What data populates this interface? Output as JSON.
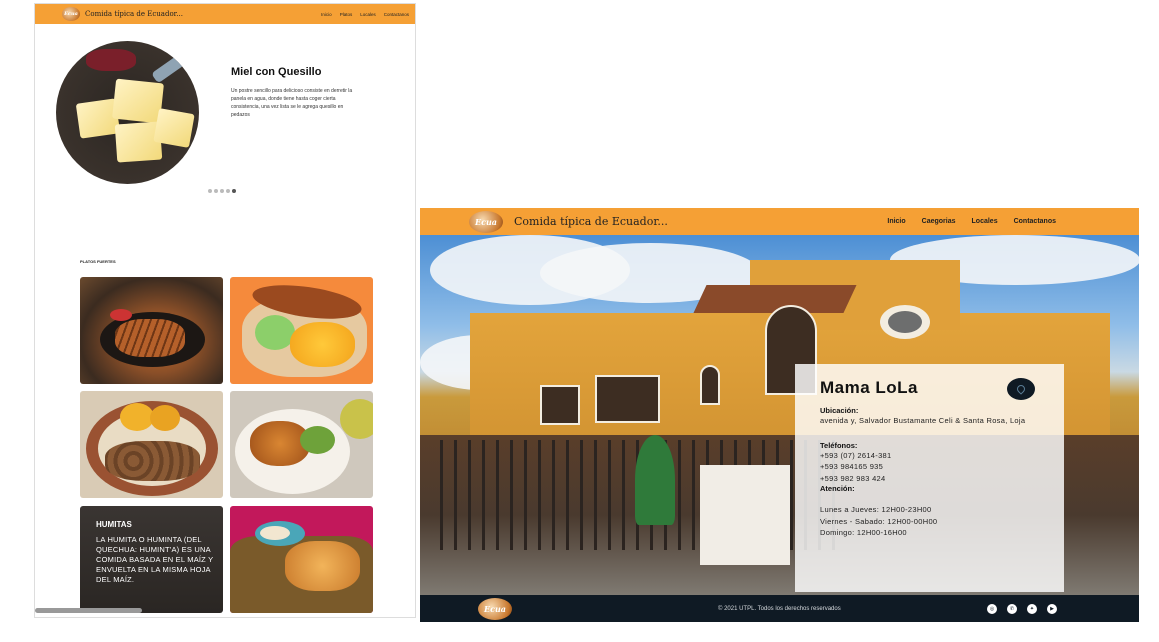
{
  "left_panel": {
    "navbar": {
      "logo": "Ecua",
      "brand": "Comida típica de Ecuador...",
      "links": [
        "Inicio",
        "Platos",
        "Locales",
        "Contactanos"
      ]
    },
    "carousel": {
      "title": "Miel con Quesillo",
      "description": "Un postre sencillo para delicioso consiste en derretir la panela en agua, donde tiene hasta coger cierta consistencia, una vez lista se le agrega quesillo en pedazos",
      "dots": 5,
      "active_dot": 4
    },
    "section_label": "PLATOS FUERTES",
    "cards": [
      {
        "name": "grilled-meat-dish",
        "colors": [
          "#7a4a2a",
          "#c46a2e",
          "#3b2b20"
        ]
      },
      {
        "name": "cuy-dish",
        "colors": [
          "#f58a3c",
          "#f2a548",
          "#c9832c"
        ]
      },
      {
        "name": "fritada-dish",
        "colors": [
          "#9a6a45",
          "#d7b27a",
          "#5a3d28"
        ]
      },
      {
        "name": "roast-chicken-dish",
        "colors": [
          "#b36b2a",
          "#e8d9c0",
          "#6e8a3a"
        ]
      },
      {
        "name": "humitas-card",
        "title": "HUMITAS",
        "description": "LA HUMITA O HUMINTA (DEL QUECHUA: HUMINT'A) ES UNA COMIDA BASADA EN EL MAÍZ Y ENVUELTA EN LA MISMA HOJA DEL MAÍZ."
      },
      {
        "name": "tamal-dish",
        "colors": [
          "#c2185b",
          "#e0a05a",
          "#8a5a2a"
        ]
      }
    ]
  },
  "right_panel": {
    "navbar": {
      "logo": "Ecua",
      "brand": "Comida típica de Ecuador...",
      "links": [
        "Inicio",
        "Caegorias",
        "Locales",
        "Contactanos"
      ]
    },
    "info": {
      "title": "Mama LoLa",
      "location_label": "Ubicación:",
      "location": "avenida y, Salvador Bustamante Celi & Santa Rosa, Loja",
      "phones_label": "Teléfonos:",
      "phones": [
        "+593 (07) 2614-381",
        "+593 984165 935",
        "+593 982 983 424"
      ],
      "hours_label": "Atención:",
      "hours": [
        "Lunes a Jueves: 12H00-23H00",
        "Viernes - Sabado: 12H00-00H00",
        "Domingo: 12H00-16H00"
      ]
    },
    "footer": {
      "logo": "Ecua",
      "copyright": "© 2021 UTPL. Todos los derechos reservados",
      "socials": [
        "instagram-icon",
        "whatsapp-icon",
        "twitter-icon",
        "youtube-icon"
      ]
    }
  }
}
